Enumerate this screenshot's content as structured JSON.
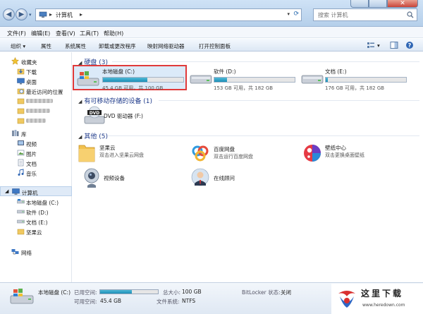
{
  "address": {
    "location": "计算机"
  },
  "search": {
    "placeholder": "搜索 计算机"
  },
  "window": {
    "close_label": "✕"
  },
  "menu": [
    "文件(F)",
    "编辑(E)",
    "查看(V)",
    "工具(T)",
    "帮助(H)"
  ],
  "toolbar": {
    "organize": "组织 ▾",
    "properties": "属性",
    "system_properties": "系统属性",
    "uninstall": "卸载或更改程序",
    "map_drive": "映射网络驱动器",
    "control_panel": "打开控制面板"
  },
  "sidebar": {
    "favorites": "收藏夹",
    "downloads": "下载",
    "desktop": "桌面",
    "recent": "最近访问的位置",
    "libraries": "库",
    "videos": "视频",
    "pictures": "图片",
    "documents": "文档",
    "music": "音乐",
    "computer": "计算机",
    "local_disk": "本地磁盘 (C:)",
    "software": "软件 (D:)",
    "docs_drive": "文档 (E:)",
    "jianguoyun": "坚果云",
    "network": "网络"
  },
  "groups": {
    "hard_disks": "硬盘 (3)",
    "removable": "有可移动存储的设备 (1)",
    "other": "其他 (5)"
  },
  "drives": [
    {
      "name": "本地磁盘 (C:)",
      "free": "45.4 GB 可用，共 100 GB",
      "used_fraction": 0.55
    },
    {
      "name": "软件 (D:)",
      "free": "153 GB 可用，共 182 GB",
      "used_fraction": 0.16
    },
    {
      "name": "文档 (E:)",
      "free": "176 GB 可用，共 182 GB",
      "used_fraction": 0.03
    }
  ],
  "removable": {
    "name": "DVD 驱动器 (F:)"
  },
  "other": [
    {
      "name": "坚果云",
      "desc": "双击进入坚果云网盘"
    },
    {
      "name": "百度网盘",
      "desc": "双击运行百度网盘"
    },
    {
      "name": "壁纸中心",
      "desc": "双击更换桌面壁纸"
    },
    {
      "name": "视频设备",
      "desc": ""
    },
    {
      "name": "在线顾问",
      "desc": ""
    }
  ],
  "status": {
    "name": "本地磁盘 (C:)",
    "used_label": "已用空间:",
    "free_label": "可用空间:",
    "free_value": "45.4 GB",
    "total_label": "总大小:",
    "total_value": "100 GB",
    "fs_label": "文件系统:",
    "fs_value": "NTFS",
    "bitlocker_label": "BitLocker 状态:",
    "bitlocker_value": "关闭",
    "used_fraction": 0.55
  },
  "watermark": {
    "title": "这里下载",
    "url": "www.heredown.com"
  }
}
